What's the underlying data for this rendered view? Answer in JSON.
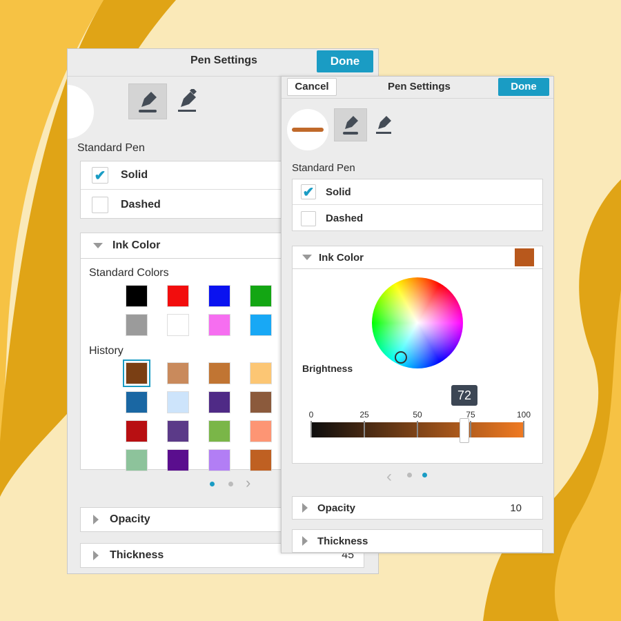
{
  "left_panel": {
    "title": "Pen Settings",
    "done_label": "Done",
    "section_label": "Standard Pen",
    "line_styles": [
      {
        "label": "Solid",
        "checked": true
      },
      {
        "label": "Dashed",
        "checked": false
      }
    ],
    "ink_color_label": "Ink Color",
    "standard_colors_label": "Standard Colors",
    "standard_colors": [
      "#000000",
      "#f20d0d",
      "#0a12f0",
      "#13a613",
      "#9b9b9b",
      "#ffffff",
      "#f66ef0",
      "#18a8f5"
    ],
    "history_label": "History",
    "history_colors": [
      "#7a3f14",
      "#c98a5c",
      "#c17533",
      "#fcc674",
      "#1a67a3",
      "#cde4fb",
      "#4f2a86",
      "#8b5a3c",
      "#b80f12",
      "#5b3a88",
      "#7ab648",
      "#fd9574",
      "#8dc39b",
      "#5a0e8e",
      "#b27ef5",
      "#bf6022"
    ],
    "selected_history_index": 0,
    "opacity_label": "Opacity",
    "thickness_label": "Thickness",
    "thickness_value": "45"
  },
  "right_panel": {
    "cancel_label": "Cancel",
    "title": "Pen Settings",
    "done_label": "Done",
    "section_label": "Standard Pen",
    "line_styles": [
      {
        "label": "Solid",
        "checked": true
      },
      {
        "label": "Dashed",
        "checked": false
      }
    ],
    "ink_color_label": "Ink Color",
    "ink_color": "#b8581c",
    "brightness_label": "Brightness",
    "brightness_value": "72",
    "brightness_ticks": [
      "0",
      "25",
      "50",
      "75",
      "100"
    ],
    "opacity_label": "Opacity",
    "opacity_value": "10",
    "thickness_label": "Thickness"
  },
  "colors": {
    "accent": "#1a9cc4",
    "pen_stroke": "#c0692a"
  }
}
